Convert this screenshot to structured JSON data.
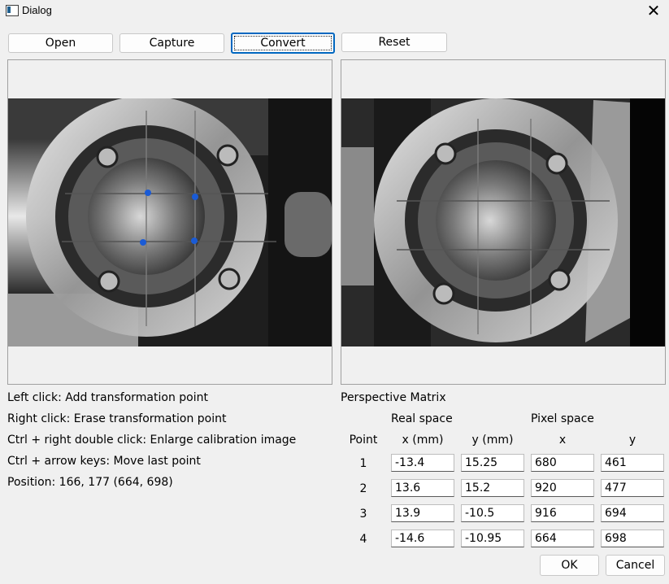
{
  "window": {
    "title": "Dialog",
    "close_glyph": "✕"
  },
  "toolbar": {
    "open": "Open",
    "capture": "Capture",
    "convert": "Convert",
    "reset": "Reset"
  },
  "info": {
    "line1": "Left click: Add transformation point",
    "line2": "Right click: Erase transformation point",
    "line3": "Ctrl + right double click: Enlarge calibration image",
    "line4": "Ctrl + arrow keys: Move last point",
    "position": "Position: 166, 177 (664, 698)"
  },
  "matrix": {
    "title": "Perspective Matrix",
    "real_space": "Real space",
    "pixel_space": "Pixel space",
    "col_point": "Point",
    "col_x_mm": "x (mm)",
    "col_y_mm": "y (mm)",
    "col_x": "x",
    "col_y": "y",
    "rows": [
      {
        "point": "1",
        "x_mm": "-13.4",
        "y_mm": "15.25",
        "x": "680",
        "y": "461"
      },
      {
        "point": "2",
        "x_mm": "13.6",
        "y_mm": "15.2",
        "x": "920",
        "y": "477"
      },
      {
        "point": "3",
        "x_mm": "13.9",
        "y_mm": "-10.5",
        "x": "916",
        "y": "694"
      },
      {
        "point": "4",
        "x_mm": "-14.6",
        "y_mm": "-10.95",
        "x": "664",
        "y": "698"
      }
    ]
  },
  "dialog_buttons": {
    "ok": "OK",
    "cancel": "Cancel"
  },
  "colors": {
    "accent": "#0067c0",
    "marker": "#1a5bd6"
  }
}
